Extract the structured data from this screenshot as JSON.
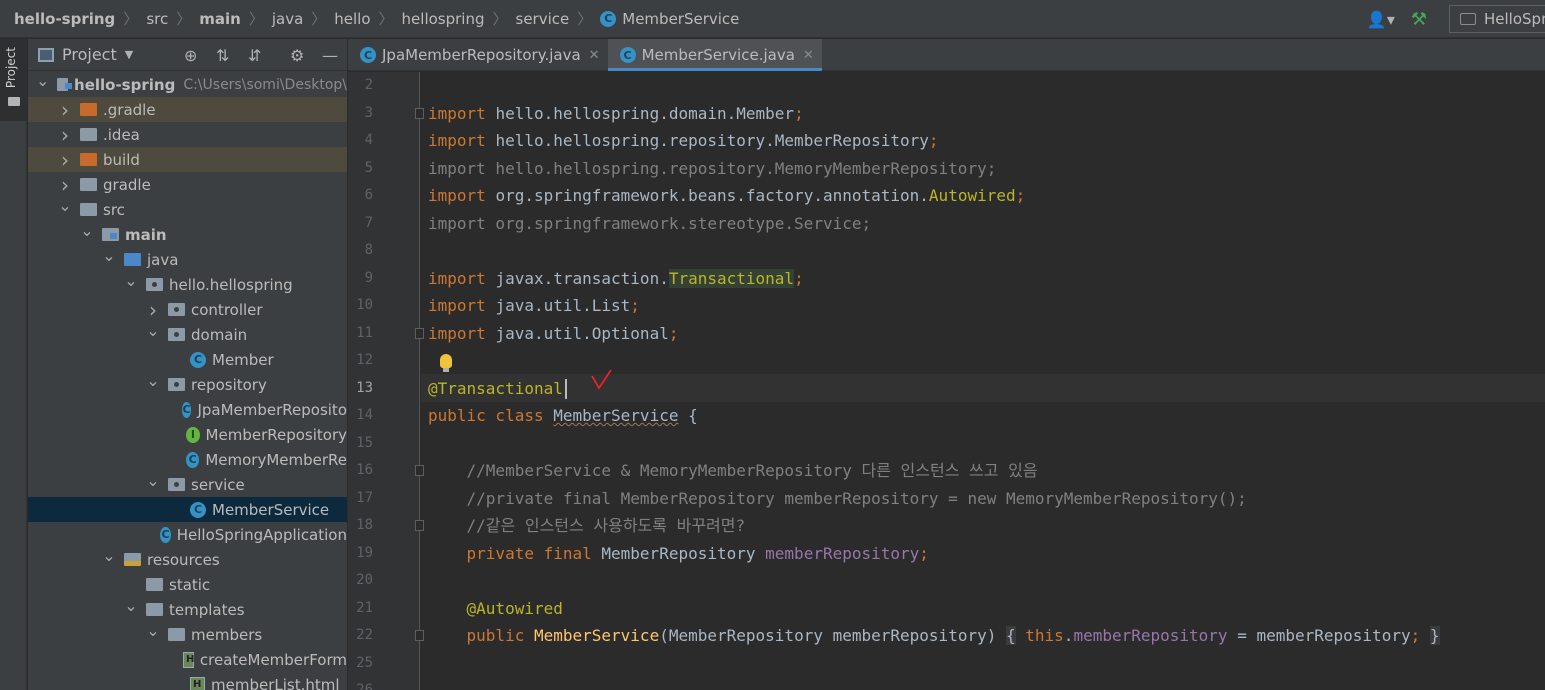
{
  "breadcrumbs": [
    {
      "label": "hello-spring",
      "bold": true
    },
    {
      "label": "src",
      "bold": false
    },
    {
      "label": "main",
      "bold": true
    },
    {
      "label": "java",
      "bold": false
    },
    {
      "label": "hello",
      "bold": false
    },
    {
      "label": "hellospring",
      "bold": false
    },
    {
      "label": "service",
      "bold": false
    },
    {
      "label": "MemberService",
      "bold": false,
      "icon": "class-icon"
    }
  ],
  "toolbar": {
    "run_config_label": "HelloSpr",
    "icons": [
      "user-vcs-icon",
      "build-hammer-icon",
      "run-config-icon"
    ]
  },
  "stripe": {
    "label": "Project"
  },
  "project_panel": {
    "title": "Project",
    "header_icons": [
      "locate-icon",
      "expand-all-icon",
      "collapse-all-icon",
      "settings-gear-icon",
      "hide-icon"
    ],
    "tree": [
      {
        "label": "hello-spring",
        "bold": true,
        "detail": "C:\\Users\\somi\\Desktop\\",
        "depth": 0,
        "arrow": "open",
        "icon": "module"
      },
      {
        "label": ".gradle",
        "depth": 1,
        "arrow": "closed",
        "icon": "orange",
        "excluded": true
      },
      {
        "label": ".idea",
        "depth": 1,
        "arrow": "closed",
        "icon": "gray"
      },
      {
        "label": "build",
        "depth": 1,
        "arrow": "closed",
        "icon": "orange",
        "excluded": true
      },
      {
        "label": "gradle",
        "depth": 1,
        "arrow": "closed",
        "icon": "gray"
      },
      {
        "label": "src",
        "depth": 1,
        "arrow": "open",
        "icon": "gray"
      },
      {
        "label": "main",
        "bold": true,
        "depth": 2,
        "arrow": "open",
        "icon": "module"
      },
      {
        "label": "java",
        "depth": 3,
        "arrow": "open",
        "icon": "blue"
      },
      {
        "label": "hello.hellospring",
        "depth": 4,
        "arrow": "open",
        "icon": "pkg"
      },
      {
        "label": "controller",
        "depth": 5,
        "arrow": "closed",
        "icon": "pkg"
      },
      {
        "label": "domain",
        "depth": 5,
        "arrow": "open",
        "icon": "pkg"
      },
      {
        "label": "Member",
        "depth": 6,
        "arrow": "none",
        "icon": "class"
      },
      {
        "label": "repository",
        "depth": 5,
        "arrow": "open",
        "icon": "pkg"
      },
      {
        "label": "JpaMemberReposito",
        "depth": 6,
        "arrow": "none",
        "icon": "class"
      },
      {
        "label": "MemberRepository",
        "depth": 6,
        "arrow": "none",
        "icon": "interface"
      },
      {
        "label": "MemoryMemberRe",
        "depth": 6,
        "arrow": "none",
        "icon": "class"
      },
      {
        "label": "service",
        "depth": 5,
        "arrow": "open",
        "icon": "pkg"
      },
      {
        "label": "MemberService",
        "depth": 6,
        "arrow": "none",
        "icon": "class",
        "selected": true
      },
      {
        "label": "HelloSpringApplication",
        "depth": 5,
        "arrow": "none",
        "icon": "class"
      },
      {
        "label": "resources",
        "depth": 3,
        "arrow": "open",
        "icon": "res"
      },
      {
        "label": "static",
        "depth": 4,
        "arrow": "none",
        "icon": "gray"
      },
      {
        "label": "templates",
        "depth": 4,
        "arrow": "open",
        "icon": "gray"
      },
      {
        "label": "members",
        "depth": 5,
        "arrow": "open",
        "icon": "gray"
      },
      {
        "label": "createMemberForm",
        "depth": 6,
        "arrow": "none",
        "icon": "html"
      },
      {
        "label": "memberList.html",
        "depth": 6,
        "arrow": "none",
        "icon": "html"
      }
    ]
  },
  "tabs": [
    {
      "label": "JpaMemberRepository.java",
      "active": false
    },
    {
      "label": "MemberService.java",
      "active": true
    }
  ],
  "editor": {
    "lines": [
      {
        "n": "2",
        "tokens": []
      },
      {
        "n": "3",
        "fold": true,
        "tokens": [
          [
            "kw",
            "import"
          ],
          [
            "",
            "hello.hellospring.domain.Member"
          ],
          [
            "kw",
            ";"
          ]
        ]
      },
      {
        "n": "4",
        "tokens": [
          [
            "kw",
            "import"
          ],
          [
            "",
            "hello.hellospring.repository.MemberRepository"
          ],
          [
            "kw",
            ";"
          ]
        ]
      },
      {
        "n": "5",
        "tokens": [
          [
            "gray",
            "import hello.hellospring.repository.MemoryMemberRepository;"
          ]
        ]
      },
      {
        "n": "6",
        "tokens": [
          [
            "kw",
            "import"
          ],
          [
            "",
            "org.springframework.beans.factory.annotation."
          ],
          [
            "ann",
            "Autowired"
          ],
          [
            "kw",
            ";"
          ]
        ]
      },
      {
        "n": "7",
        "tokens": [
          [
            "gray",
            "import org.springframework.stereotype.Service;"
          ]
        ]
      },
      {
        "n": "8",
        "tokens": []
      },
      {
        "n": "9",
        "tokens": [
          [
            "kw",
            "import"
          ],
          [
            "",
            "javax.transaction."
          ],
          [
            "ann hl",
            "Transactional"
          ],
          [
            "kw",
            ";"
          ]
        ]
      },
      {
        "n": "10",
        "tokens": [
          [
            "kw",
            "import"
          ],
          [
            "",
            "java.util.List"
          ],
          [
            "kw",
            ";"
          ]
        ]
      },
      {
        "n": "11",
        "fold": true,
        "tokens": [
          [
            "kw",
            "import"
          ],
          [
            "",
            "java.util.Optional"
          ],
          [
            "kw",
            ";"
          ]
        ]
      },
      {
        "n": "12",
        "tokens": []
      },
      {
        "n": "13",
        "current": true,
        "tokens": [
          [
            "ann",
            "@Transactional"
          ]
        ]
      },
      {
        "n": "14",
        "tokens": [
          [
            "kw",
            "public class "
          ],
          [
            "squig",
            "MemberService"
          ],
          [
            "",
            " {"
          ]
        ]
      },
      {
        "n": "15",
        "tokens": []
      },
      {
        "n": "16",
        "fold": true,
        "tokens": [
          [
            "cmt",
            "    //MemberService & MemoryMemberRepository 다른 인스턴스 쓰고 있음"
          ]
        ]
      },
      {
        "n": "17",
        "tokens": [
          [
            "cmt",
            "    //private final MemberRepository memberRepository = new MemoryMemberRepository();"
          ]
        ]
      },
      {
        "n": "18",
        "fold": true,
        "tokens": [
          [
            "cmt",
            "    //같은 인스턴스 사용하도록 바꾸려면?"
          ]
        ]
      },
      {
        "n": "19",
        "tokens": [
          [
            "kw",
            "    private final "
          ],
          [
            "",
            "MemberRepository "
          ],
          [
            "field",
            "memberRepository"
          ],
          [
            "kw",
            ";"
          ]
        ]
      },
      {
        "n": "20",
        "tokens": []
      },
      {
        "n": "21",
        "tokens": [
          [
            "ann",
            "    @Autowired"
          ]
        ]
      },
      {
        "n": "22",
        "fold": true,
        "tokens": [
          [
            "kw",
            "    public "
          ],
          [
            "fn",
            "MemberService"
          ],
          [
            "",
            "(MemberRepository memberRepository) "
          ],
          [
            "brace",
            "{"
          ],
          [
            "",
            " "
          ],
          [
            "kw",
            "this"
          ],
          [
            "",
            "."
          ],
          [
            "field",
            "memberRepository"
          ],
          [
            "",
            " = memberRepository"
          ],
          [
            "kw",
            ";"
          ],
          [
            "",
            " "
          ],
          [
            "brace",
            "}"
          ]
        ]
      },
      {
        "n": "25",
        "tokens": []
      },
      {
        "n": "26",
        "tokens": []
      }
    ]
  }
}
